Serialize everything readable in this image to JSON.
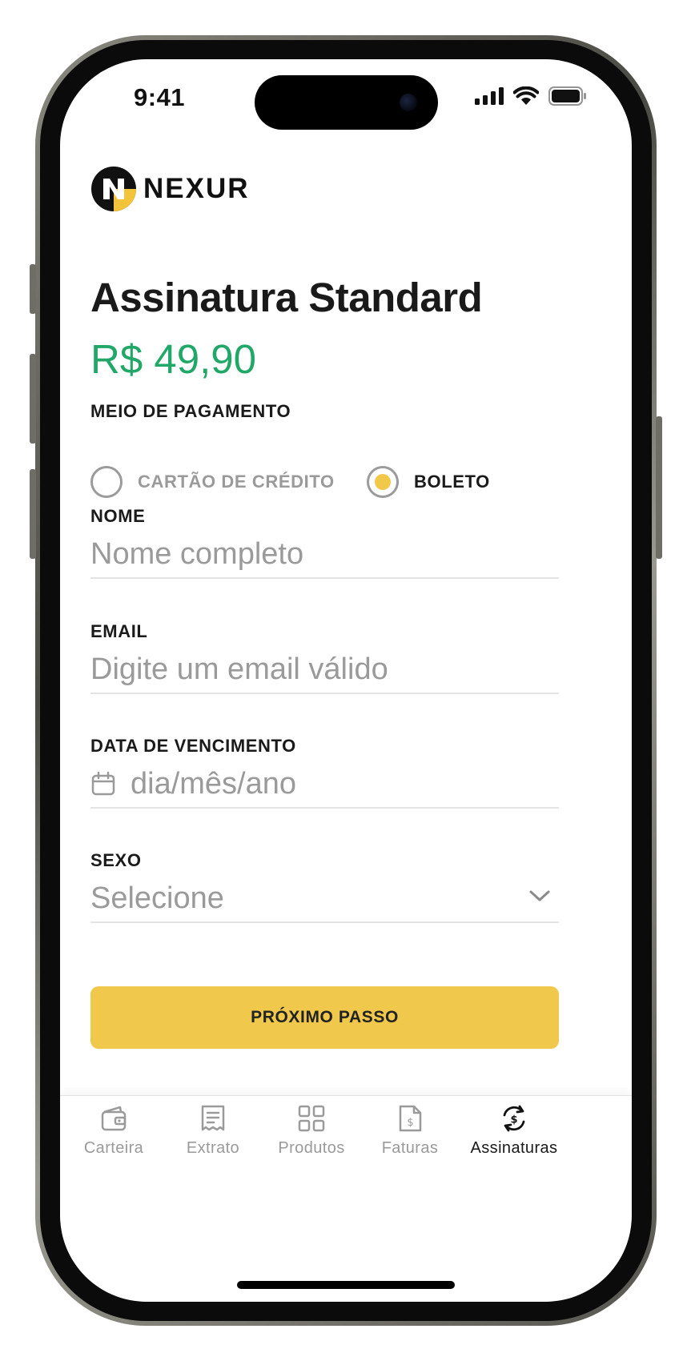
{
  "status_bar": {
    "time": "9:41"
  },
  "brand": {
    "name": "NEXUR",
    "logo_colors": {
      "dark": "#111111",
      "accent": "#f3c33a"
    }
  },
  "plan": {
    "title": "Assinatura Standard",
    "price": "R$ 49,90",
    "price_color": "#21a768"
  },
  "payment": {
    "label": "MEIO DE PAGAMENTO",
    "options": [
      {
        "label": "CARTÃO DE CRÉDITO",
        "selected": false
      },
      {
        "label": "BOLETO",
        "selected": true
      }
    ]
  },
  "form": {
    "name": {
      "label": "NOME",
      "placeholder": "Nome completo"
    },
    "email": {
      "label": "EMAIL",
      "placeholder": "Digite um email válido"
    },
    "due_date": {
      "label": "DATA DE VENCIMENTO",
      "placeholder": "dia/mês/ano",
      "icon": "calendar-icon"
    },
    "sex": {
      "label": "SEXO",
      "selected": "Selecione",
      "icon": "chevron-down-icon"
    }
  },
  "next_button": {
    "label": "PRÓXIMO PASSO",
    "color": "#f0c84b"
  },
  "tabs": [
    {
      "label": "Carteira",
      "icon": "wallet-icon",
      "active": false
    },
    {
      "label": "Extrato",
      "icon": "receipt-icon",
      "active": false
    },
    {
      "label": "Produtos",
      "icon": "grid-icon",
      "active": false
    },
    {
      "label": "Faturas",
      "icon": "invoice-icon",
      "active": false
    },
    {
      "label": "Assinaturas",
      "icon": "subscription-icon",
      "active": true
    }
  ]
}
